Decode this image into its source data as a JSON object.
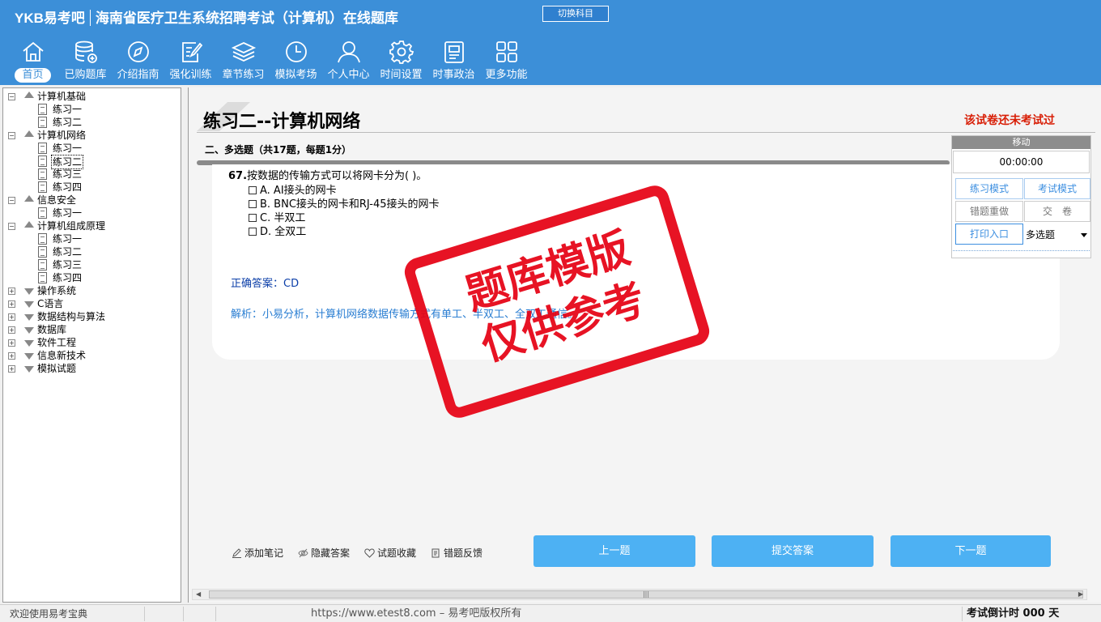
{
  "app": {
    "brand": "YKB易考吧",
    "title": "海南省医疗卫生系统招聘考试（计算机）在线题库",
    "switch_subject": "切换科目",
    "accent_color": "#3c8fd8"
  },
  "nav": [
    {
      "label": "首页",
      "icon": "home-icon",
      "active": true
    },
    {
      "label": "已购题库",
      "icon": "database-icon"
    },
    {
      "label": "介绍指南",
      "icon": "compass-icon"
    },
    {
      "label": "强化训练",
      "icon": "edit-icon"
    },
    {
      "label": "章节练习",
      "icon": "layers-icon"
    },
    {
      "label": "模拟考场",
      "icon": "clock-icon"
    },
    {
      "label": "个人中心",
      "icon": "user-icon"
    },
    {
      "label": "时间设置",
      "icon": "gear-icon"
    },
    {
      "label": "时事政治",
      "icon": "news-icon"
    },
    {
      "label": "更多功能",
      "icon": "grid-icon"
    }
  ],
  "tree": [
    {
      "label": "计算机基础",
      "level": 0,
      "expanded": true
    },
    {
      "label": "练习一",
      "level": 1
    },
    {
      "label": "练习二",
      "level": 1
    },
    {
      "label": "计算机网络",
      "level": 0,
      "expanded": true
    },
    {
      "label": "练习一",
      "level": 1
    },
    {
      "label": "练习二",
      "level": 1,
      "selected": true
    },
    {
      "label": "练习三",
      "level": 1
    },
    {
      "label": "练习四",
      "level": 1
    },
    {
      "label": "信息安全",
      "level": 0,
      "expanded": true
    },
    {
      "label": "练习一",
      "level": 1
    },
    {
      "label": "计算机组成原理",
      "level": 0,
      "expanded": true
    },
    {
      "label": "练习一",
      "level": 1
    },
    {
      "label": "练习二",
      "level": 1
    },
    {
      "label": "练习三",
      "level": 1
    },
    {
      "label": "练习四",
      "level": 1
    },
    {
      "label": "操作系统",
      "level": 0,
      "expanded": false
    },
    {
      "label": "C语言",
      "level": 0,
      "expanded": false
    },
    {
      "label": "数据结构与算法",
      "level": 0,
      "expanded": false
    },
    {
      "label": "数据库",
      "level": 0,
      "expanded": false
    },
    {
      "label": "软件工程",
      "level": 0,
      "expanded": false
    },
    {
      "label": "信息新技术",
      "level": 0,
      "expanded": false
    },
    {
      "label": "模拟试题",
      "level": 0,
      "expanded": false
    }
  ],
  "paper": {
    "title": "练习二--计算机网络",
    "status": "该试卷还未考试过",
    "section": "二、多选题（共17题，每题1分）"
  },
  "question": {
    "number": "67.",
    "stem": "按数据的传输方式可以将网卡分为( )。",
    "options": [
      "A. AI接头的网卡",
      "B. BNC接头的网卡和RJ-45接头的网卡",
      "C. 半双工",
      "D. 全双工"
    ],
    "answer": "正确答案：CD",
    "analysis": "解析：小易分析，计算机网络数据传输方式有单工、半双工、全双工通信。"
  },
  "control": {
    "header": "移动",
    "timer": "00:00:00",
    "practice_mode": "练习模式",
    "exam_mode": "考试模式",
    "redo_wrong": "错题重做",
    "submit_paper": "交　卷",
    "print_entry": "打印入口",
    "type_select": "多选题"
  },
  "tools": {
    "add_note": "添加笔记",
    "hide_answer": "隐藏答案",
    "favorite": "试题收藏",
    "feedback": "错题反馈"
  },
  "buttons": {
    "prev": "上一题",
    "submit": "提交答案",
    "next": "下一题"
  },
  "footer": {
    "welcome": "欢迎使用易考宝典",
    "url": "https://www.etest8.com – 易考吧版权所有",
    "countdown": "考试倒计时 000 天"
  },
  "stamp": {
    "line1": "题库模版",
    "line2": "仅供参考",
    "color": "#e60012"
  }
}
